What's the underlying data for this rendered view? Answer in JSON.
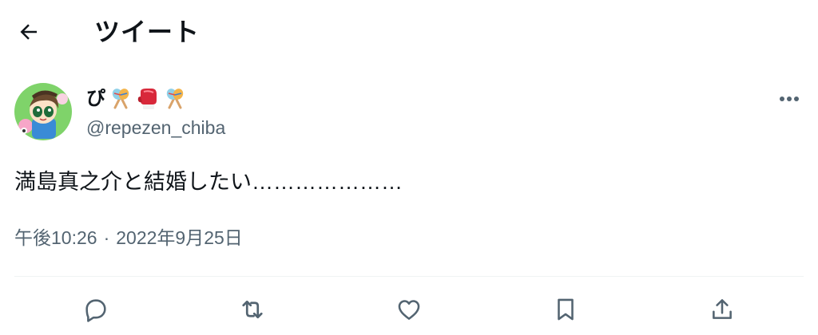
{
  "header": {
    "title": "ツイート",
    "back_icon": "arrow-left-icon"
  },
  "tweet": {
    "author": {
      "display_name": "ぴ",
      "name_emojis": [
        "maracas-emoji",
        "boxing-glove-emoji",
        "maracas-emoji"
      ],
      "handle": "@repezen_chiba",
      "avatar_icon": "avatar-image"
    },
    "text": "満島真之介と結婚したい…………………",
    "time": "午後10:26",
    "separator": "·",
    "date": "2022年9月25日"
  },
  "actions": [
    {
      "name": "reply",
      "icon": "reply-icon"
    },
    {
      "name": "retweet",
      "icon": "retweet-icon"
    },
    {
      "name": "like",
      "icon": "heart-icon"
    },
    {
      "name": "bookmark",
      "icon": "bookmark-icon"
    },
    {
      "name": "share",
      "icon": "share-icon"
    }
  ],
  "colors": {
    "text_primary": "#0f1419",
    "text_secondary": "#536471",
    "divider": "#eff3f4"
  }
}
